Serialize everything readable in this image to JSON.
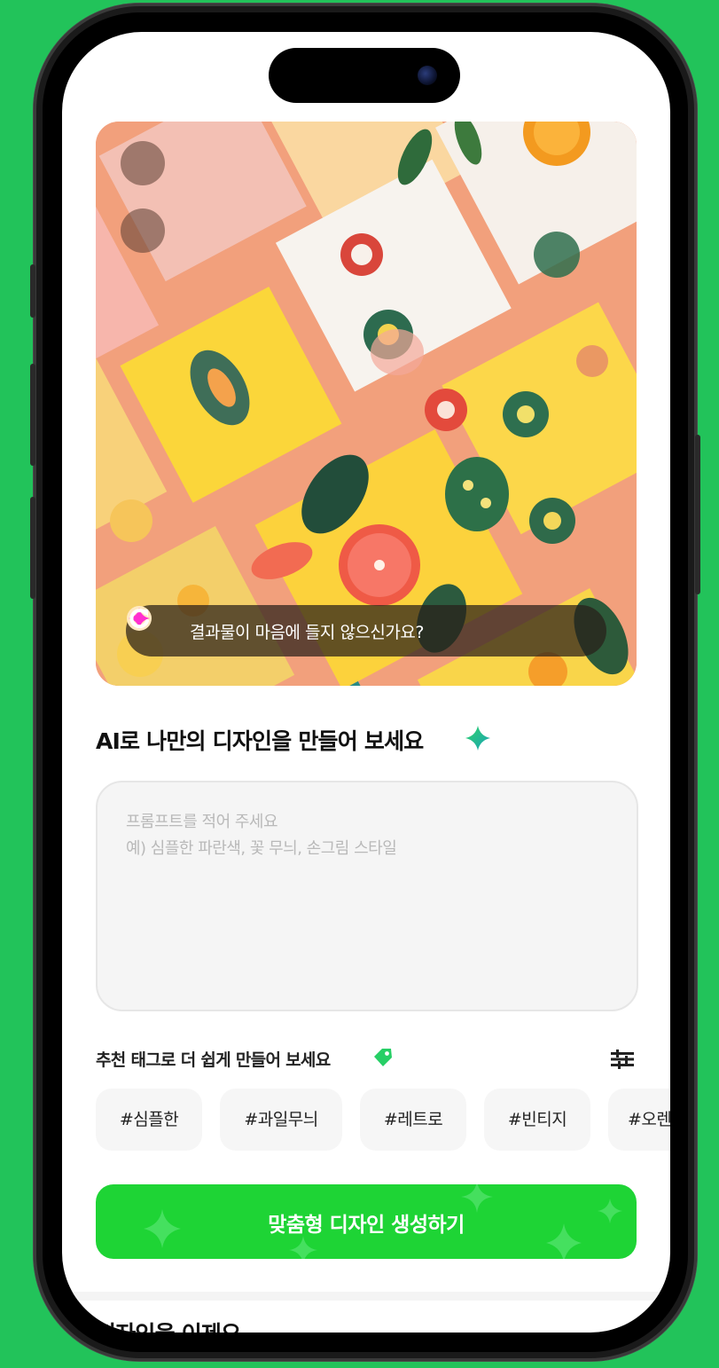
{
  "hero": {
    "feedback_text": "결과물이 마음에 들지 않으신가요?"
  },
  "main": {
    "section_title": "AI로 나만의 디자인을 만들어 보세요",
    "prompt_placeholder": "프롬프트를 적어 주세요\n예) 심플한 파란색, 꽃 무늬, 손그림 스타일",
    "tags_title": "추천 태그로 더 쉽게 만들어 보세요",
    "tags": [
      "#심플한",
      "#과일무늬",
      "#레트로",
      "#빈티지",
      "#오렌"
    ],
    "cta_label": "맞춤형 디자인 생성하기",
    "next_section_title": "디자인을 이제요"
  },
  "icons": {
    "feedback": "sparkle-icon",
    "refresh": "refresh-icon",
    "title_spark": "sparkle-icon",
    "tag": "tag-icon",
    "filter": "filter-icon"
  },
  "colors": {
    "background": "#22c35a",
    "cta": "#1ed435",
    "feedback_sparkle": "#ff2fd0"
  }
}
